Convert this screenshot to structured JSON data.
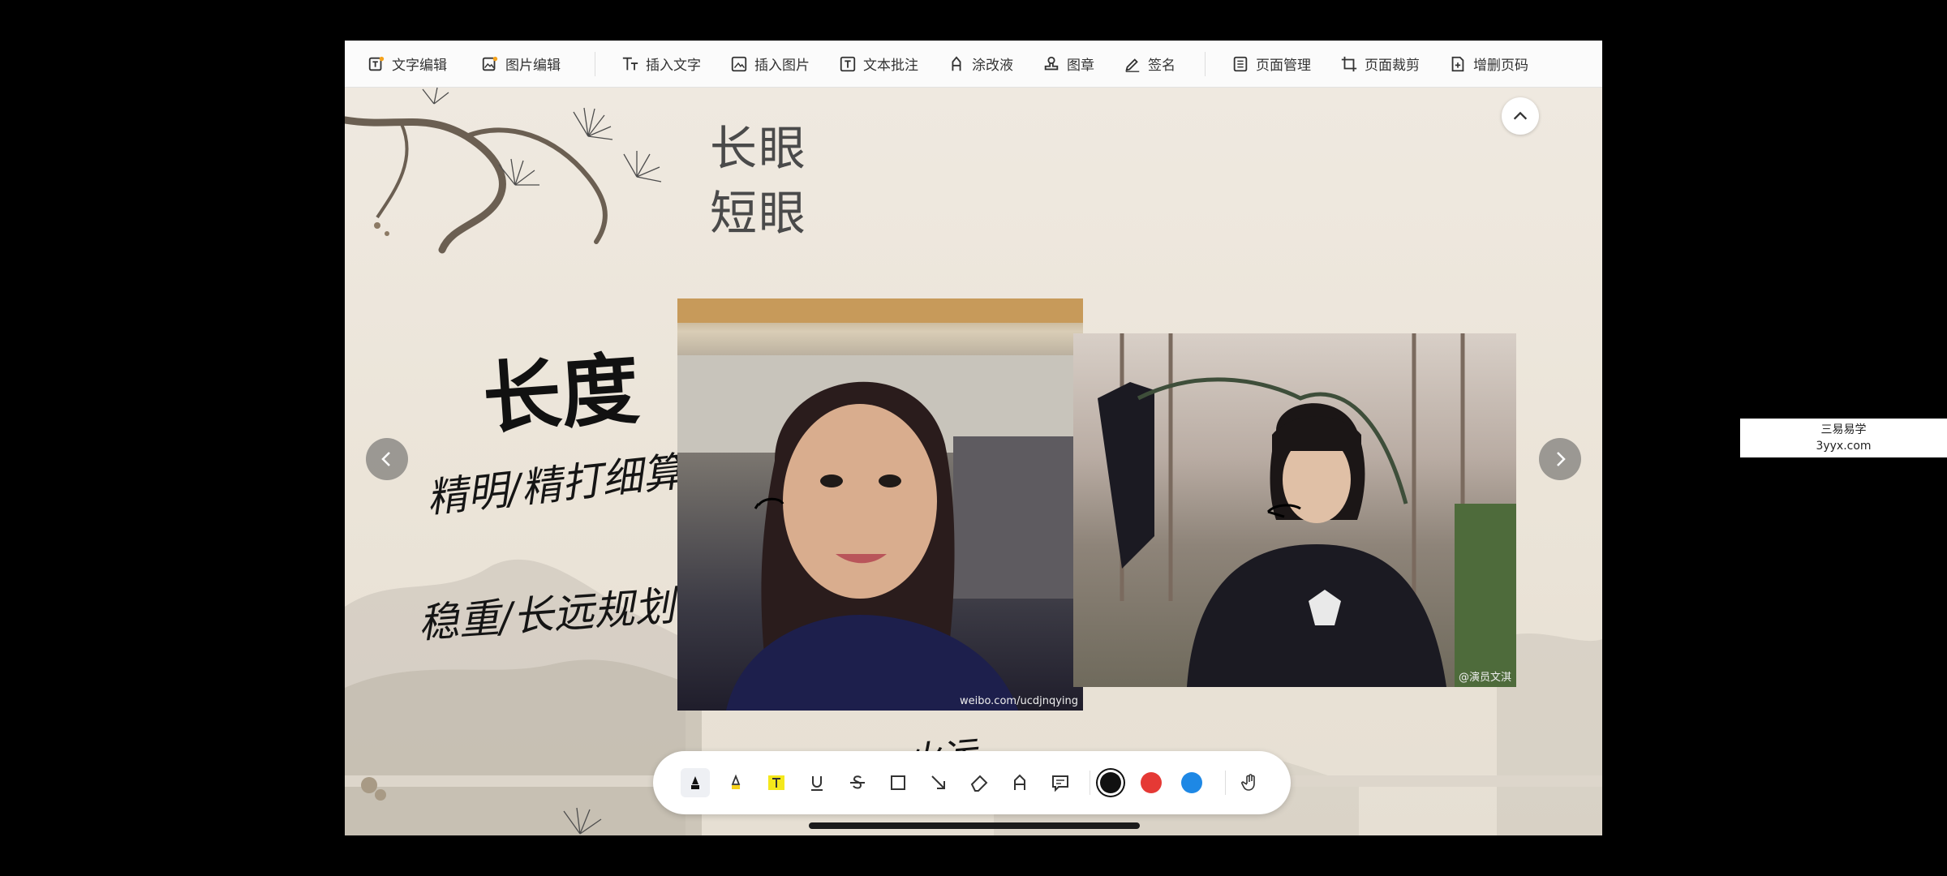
{
  "toolbar": {
    "items": [
      {
        "label": "文字编辑",
        "icon": "text-edit-icon"
      },
      {
        "label": "图片编辑",
        "icon": "image-edit-icon"
      },
      {
        "label": "插入文字",
        "icon": "insert-text-icon"
      },
      {
        "label": "插入图片",
        "icon": "insert-image-icon"
      },
      {
        "label": "文本批注",
        "icon": "text-annotation-icon"
      },
      {
        "label": "涂改液",
        "icon": "correction-fluid-icon"
      },
      {
        "label": "图章",
        "icon": "stamp-icon"
      },
      {
        "label": "签名",
        "icon": "signature-icon"
      },
      {
        "label": "页面管理",
        "icon": "page-manage-icon"
      },
      {
        "label": "页面裁剪",
        "icon": "page-crop-icon"
      },
      {
        "label": "增删页码",
        "icon": "page-number-icon"
      }
    ]
  },
  "slide": {
    "title_line1": "长眼",
    "title_line2": "短眼",
    "calligraphy": "长度",
    "handwriting_1": "精明/精打细算",
    "handwriting_2": "稳重/长远规划",
    "handwriting_3": "火运",
    "photo_left_caption": "weibo.com/ucdjnqying",
    "photo_right_caption": "@演员文淇"
  },
  "drawbar": {
    "tools": [
      "pen-icon",
      "highlighter-icon",
      "text-highlight-icon",
      "underline-icon",
      "strikethrough-icon",
      "rectangle-icon",
      "arrow-icon",
      "eraser-icon",
      "text-tool-icon",
      "comment-icon"
    ],
    "colors": [
      "#111111",
      "#e53935",
      "#1e88e5"
    ],
    "extra": "hand-icon"
  },
  "watermark": {
    "line1": "三易易学",
    "line2": "3yyx.com"
  }
}
